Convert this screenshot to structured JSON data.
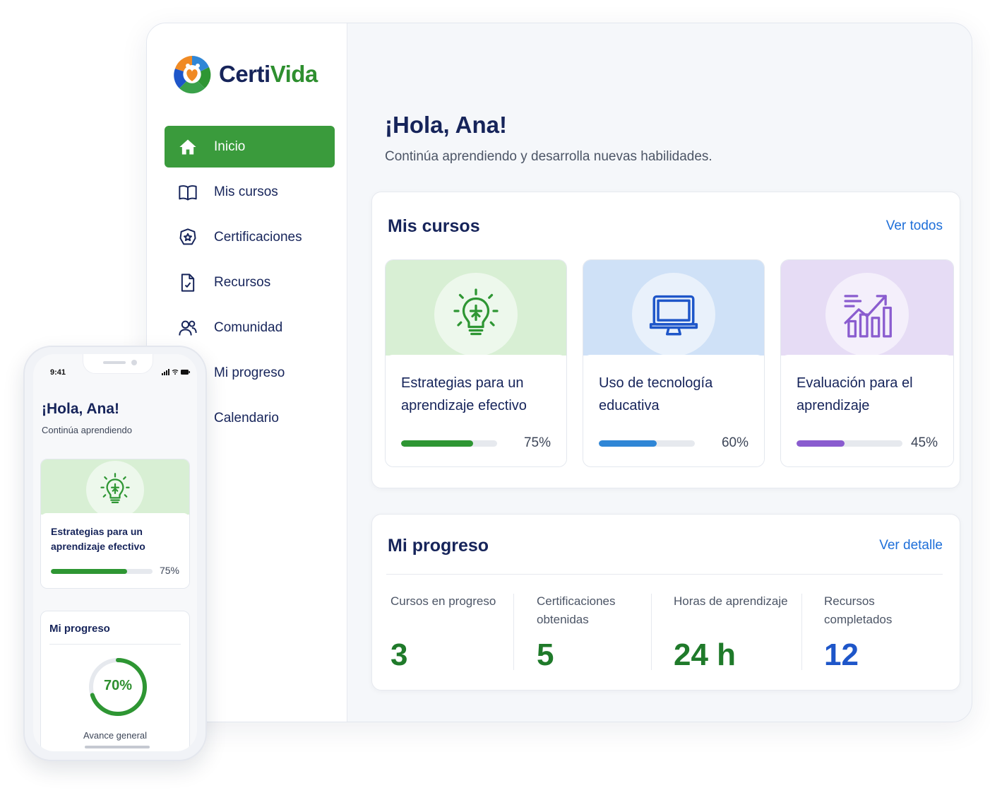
{
  "brand": {
    "name_part1": "Certi",
    "name_part2": "Vida"
  },
  "sidebar": {
    "items": [
      {
        "label": "Inicio",
        "icon": "home-icon",
        "active": true
      },
      {
        "label": "Mis cursos",
        "icon": "book-icon",
        "active": false
      },
      {
        "label": "Certificaciones",
        "icon": "badge-star-icon",
        "active": false
      },
      {
        "label": "Recursos",
        "icon": "document-icon",
        "active": false
      },
      {
        "label": "Comunidad",
        "icon": "users-icon",
        "active": false
      },
      {
        "label": "Mi progreso",
        "icon": "progress-icon",
        "active": false
      },
      {
        "label": "Calendario",
        "icon": "calendar-icon",
        "active": false
      }
    ]
  },
  "main": {
    "greeting": "¡Hola, Ana!",
    "subtitle": "Continúa aprendiendo y desarrolla nuevas habilidades.",
    "courses_section": {
      "title": "Mis cursos",
      "link": "Ver todos",
      "courses": [
        {
          "title": "Estrategias para un aprendizaje efectivo",
          "progress_label": "75%",
          "progress": 75,
          "icon": "lightbulb-icon",
          "color": "#2e9633",
          "band": "#d8efd4"
        },
        {
          "title": "Uso de tecnología educativa",
          "progress_label": "60%",
          "progress": 60,
          "icon": "monitor-icon",
          "color": "#2f86d6",
          "band": "#cfe1f7"
        },
        {
          "title": "Evaluación para el aprendizaje",
          "progress_label": "45%",
          "progress": 45,
          "icon": "chart-growth-icon",
          "color": "#8a5ccf",
          "band": "#e6dcf5"
        }
      ]
    },
    "progress_section": {
      "title": "Mi progreso",
      "link": "Ver detalle",
      "stats": [
        {
          "label": "Cursos en progreso",
          "value": "3",
          "color": "#1f7a2a"
        },
        {
          "label": "Certificaciones obtenidas",
          "value": "5",
          "color": "#1f7a2a"
        },
        {
          "label": "Horas de aprendizaje",
          "value": "24 h",
          "color": "#1f7a2a"
        },
        {
          "label": "Recursos completados",
          "value": "12",
          "color": "#1e56c9"
        }
      ]
    }
  },
  "phone": {
    "time": "9:41",
    "greeting": "¡Hola, Ana!",
    "subtitle": "Continúa aprendiendo",
    "course": {
      "title": "Estrategias para un aprendizaje efectivo",
      "progress_label": "75%",
      "progress": 75
    },
    "progress": {
      "title": "Mi progreso",
      "value_label": "70%",
      "value": 70,
      "caption": "Avance general"
    }
  }
}
